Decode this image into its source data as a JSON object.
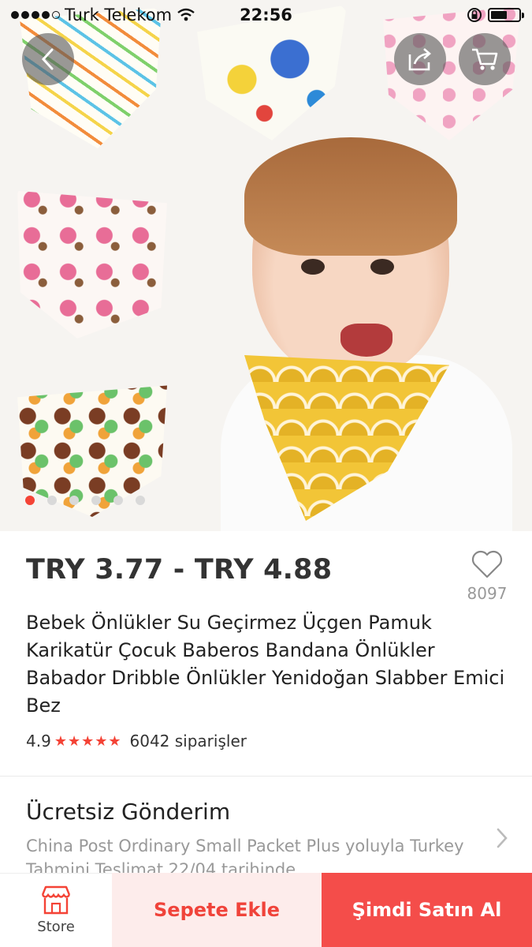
{
  "status_bar": {
    "carrier": "Turk Telekom",
    "time": "22:56",
    "battery_level": 0.6
  },
  "gallery": {
    "image_count": 6,
    "active_index": 0
  },
  "product": {
    "price": "TRY 3.77 - TRY 4.88",
    "wishlist_count": "8097",
    "title": "Bebek Önlükler Su Geçirmez Üçgen Pamuk Karikatür Çocuk Baberos Bandana Önlükler Babador Dribble Önlükler Yenidoğan Slabber Emici Bez",
    "rating": "4.9",
    "stars": "★★★★★",
    "orders": "6042 siparişler"
  },
  "shipping": {
    "title": "Ücretsiz Gönderim",
    "method": "China Post Ordinary Small Packet Plus yoluyla Turkey",
    "delivery": "Tahmini Teslimat 22/04 tarihinde"
  },
  "bottom_bar": {
    "store_label": "Store",
    "add_to_cart": "Sepete Ekle",
    "buy_now": "Şimdi Satın Al"
  },
  "colors": {
    "accent": "#f44336",
    "buy_button": "#f44d4a",
    "cart_button_bg": "#fdeceb"
  },
  "icons": [
    "back-arrow-icon",
    "share-icon",
    "cart-icon",
    "heart-icon",
    "chevron-right-icon",
    "store-icon",
    "wifi-icon",
    "lock-icon"
  ]
}
